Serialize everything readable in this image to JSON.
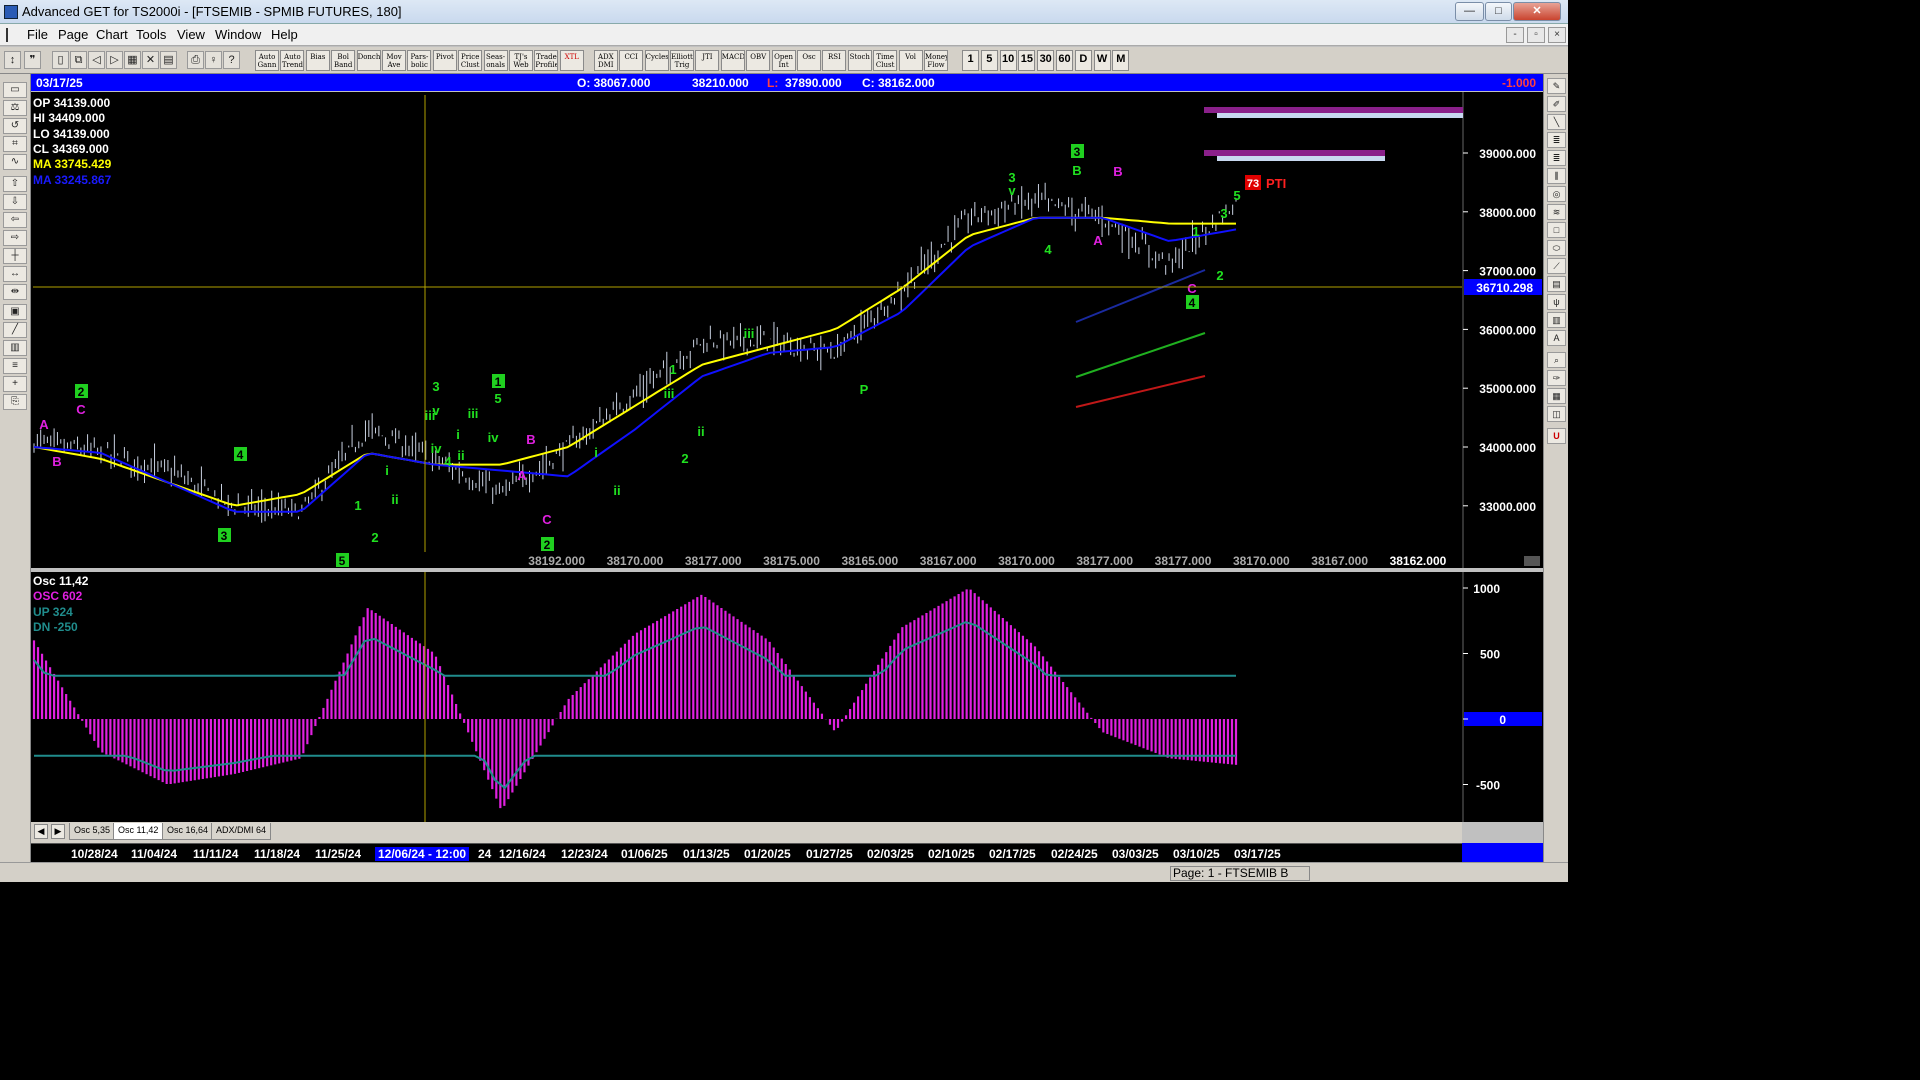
{
  "window": {
    "title": "Advanced GET for TS2000i - [FTSEMIB - SPMIB FUTURES, 180]",
    "min_label": "—",
    "max_label": "□",
    "close_label": "✕"
  },
  "menu": [
    "File",
    "Page",
    "Chart",
    "Tools",
    "View",
    "Window",
    "Help"
  ],
  "mdi_controls": [
    "-",
    "▫",
    "×"
  ],
  "toolbar": {
    "study_buttons": [
      "Auto Gann",
      "Auto Trend",
      "Bias",
      "Bol Band",
      "Donch",
      "Mov Ave",
      "Pars- bolic",
      "Pivot",
      "Price Clust",
      "Seas- onals",
      "TJ's Web",
      "Trade Profile",
      "XTL",
      "ADX DMI",
      "CCI",
      "Cycles",
      "Elliott Trig",
      "JTI",
      "MACD",
      "OBV",
      "Open Int",
      "Osc",
      "RSI",
      "Stoch",
      "Time Clust",
      "Vol",
      "Money Flow"
    ],
    "interval_buttons": [
      "1",
      "5",
      "10",
      "15",
      "30",
      "60",
      "D",
      "W",
      "M"
    ]
  },
  "price_header": {
    "date": "03/17/25",
    "open": "O: 38067.000",
    "high": "38210.000",
    "low_label": "L:",
    "low": "37890.000",
    "close": "C: 38162.000",
    "change": "-1.000"
  },
  "data_window": {
    "op": "OP  34139.000",
    "hi": "HI   34409.000",
    "lo": "LO  34139.000",
    "cl": "CL  34369.000",
    "ma1": "MA  33745.429",
    "ma2": "MA  33245.867"
  },
  "price_axis": {
    "ticks": [
      "39000.000",
      "38000.000",
      "37000.000",
      "36000.000",
      "35000.000",
      "34000.000",
      "33000.000"
    ],
    "crosshair_value": "36710.298"
  },
  "bottom_prices": [
    "38192.000",
    "38170.000",
    "38177.000",
    "38175.000",
    "38165.000",
    "38167.000",
    "38170.000",
    "38177.000",
    "38177.000",
    "38170.000",
    "38167.000",
    "38162.000"
  ],
  "pti": {
    "value": "73",
    "label": "PTI"
  },
  "elliott_labels": [
    {
      "t": "A",
      "c": "#e020e0"
    },
    {
      "t": "B",
      "c": "#e020e0"
    },
    {
      "t": "C",
      "c": "#e020e0"
    },
    {
      "t": "2",
      "c": "box"
    },
    {
      "t": "4",
      "c": "box"
    },
    {
      "t": "3",
      "c": "box"
    },
    {
      "t": "5",
      "c": "box"
    },
    {
      "t": "1",
      "c": "#20e020"
    },
    {
      "t": "2",
      "c": "#20e020"
    },
    {
      "t": "i",
      "c": "#20e020"
    },
    {
      "t": "ii",
      "c": "#20e020"
    },
    {
      "t": "3",
      "c": "#20e020"
    },
    {
      "t": "iii",
      "c": "#20e020"
    },
    {
      "t": "iv",
      "c": "#20e020"
    },
    {
      "t": "v",
      "c": "#20e020"
    },
    {
      "t": "4",
      "c": "#20e020"
    },
    {
      "t": "i",
      "c": "#20e020"
    },
    {
      "t": "ii",
      "c": "#20e020"
    },
    {
      "t": "iii",
      "c": "#20e020"
    },
    {
      "t": "iv",
      "c": "#20e020"
    },
    {
      "t": "1",
      "c": "box"
    },
    {
      "t": "5",
      "c": "#20e020"
    },
    {
      "t": "B",
      "c": "#e020e0"
    },
    {
      "t": "A",
      "c": "#e020e0"
    },
    {
      "t": "C",
      "c": "#e020e0"
    },
    {
      "t": "2",
      "c": "box"
    },
    {
      "t": "i",
      "c": "#20e020"
    },
    {
      "t": "ii",
      "c": "#20e020"
    },
    {
      "t": "1",
      "c": "#20e020"
    },
    {
      "t": "iii",
      "c": "#20e020"
    },
    {
      "t": "ii",
      "c": "#20e020"
    },
    {
      "t": "2",
      "c": "#20e020"
    },
    {
      "t": "iii",
      "c": "#20e020"
    },
    {
      "t": "P",
      "c": "#20e020"
    },
    {
      "t": "3",
      "c": "#20e020"
    },
    {
      "t": "v",
      "c": "#20e020"
    },
    {
      "t": "4",
      "c": "#20e020"
    },
    {
      "t": "3",
      "c": "box"
    },
    {
      "t": "B",
      "c": "#20e020"
    },
    {
      "t": "A",
      "c": "#e020e0"
    },
    {
      "t": "B",
      "c": "#e020e0"
    },
    {
      "t": "C",
      "c": "#e020e0"
    },
    {
      "t": "4",
      "c": "box"
    },
    {
      "t": "1",
      "c": "#20e020"
    },
    {
      "t": "2",
      "c": "#20e020"
    },
    {
      "t": "3",
      "c": "#20e020"
    },
    {
      "t": "5",
      "c": "#20e020"
    }
  ],
  "oscillator": {
    "name": "Osc 11,42",
    "osc": "OSC 602",
    "up": "UP   324",
    "dn": "DN   -250",
    "ticks": [
      "1000",
      "500",
      "0",
      "-500"
    ]
  },
  "tabs": [
    "Osc 5,35",
    "Osc 11,42",
    "Osc 16,64",
    "ADX/DMI 64"
  ],
  "dates": [
    "10/28/24",
    "11/04/24",
    "11/11/24",
    "11/18/24",
    "11/25/24",
    "12/06/24 - 12:00",
    "24",
    "12/16/24",
    "12/23/24",
    "01/06/25",
    "01/13/25",
    "01/20/25",
    "01/27/25",
    "02/03/25",
    "02/10/25",
    "02/17/25",
    "02/24/25",
    "03/03/25",
    "03/10/25",
    "03/17/25"
  ],
  "status": {
    "page": "Page: 1 - FTSEMIB B"
  },
  "colors": {
    "ma1": "#ffff00",
    "ma2": "#1010ff",
    "bars": "#c8d0e0",
    "osc_hist": "#e020e0",
    "osc_bands": "#208c8c",
    "header_bg": "#0000ff",
    "crosshair": "#b0a000"
  },
  "chart_data": [
    {
      "type": "candlestick",
      "title": "FTSEMIB - SPMIB FUTURES, 180",
      "x": [
        "10/28/24",
        "11/04/24",
        "11/11/24",
        "11/18/24",
        "11/25/24",
        "12/06/24",
        "12/16/24",
        "12/23/24",
        "01/06/25",
        "01/13/25",
        "01/20/25",
        "01/27/25",
        "02/03/25",
        "02/10/25",
        "02/17/25",
        "02/24/25",
        "03/03/25",
        "03/10/25",
        "03/17/25"
      ],
      "close_approx": [
        34100,
        33900,
        33600,
        33000,
        32900,
        34300,
        33800,
        33200,
        34000,
        34900,
        35800,
        35800,
        35600,
        36700,
        37900,
        38200,
        37900,
        37100,
        38162
      ],
      "ylim": [
        32200,
        39800
      ],
      "series": [
        {
          "name": "MA 33745.429",
          "color": "#ffff00",
          "values": [
            34000,
            33800,
            33400,
            33000,
            33200,
            33900,
            33700,
            33700,
            34000,
            34700,
            35400,
            35700,
            36000,
            36700,
            37600,
            37900,
            37900,
            37800,
            37800
          ]
        },
        {
          "name": "MA 33245.867",
          "color": "#1010ff",
          "values": [
            34000,
            33900,
            33400,
            32900,
            32900,
            33900,
            33700,
            33600,
            33500,
            34300,
            35200,
            35600,
            35700,
            36300,
            37400,
            37900,
            37900,
            37500,
            37700
          ]
        }
      ]
    },
    {
      "type": "bar",
      "title": "Osc 11,42",
      "x": [
        "10/28/24",
        "11/04/24",
        "11/11/24",
        "11/18/24",
        "11/25/24",
        "12/06/24",
        "12/16/24",
        "12/23/24",
        "01/06/25",
        "01/13/25",
        "01/20/25",
        "01/27/25",
        "02/03/25",
        "02/10/25",
        "02/17/25",
        "02/24/25",
        "03/03/25",
        "03/10/25",
        "03/17/25"
      ],
      "values": [
        600,
        -250,
        -500,
        -420,
        -300,
        850,
        500,
        -700,
        150,
        650,
        950,
        600,
        -100,
        700,
        1000,
        550,
        -100,
        -300,
        -350
      ],
      "ylim": [
        -800,
        1100
      ]
    }
  ]
}
